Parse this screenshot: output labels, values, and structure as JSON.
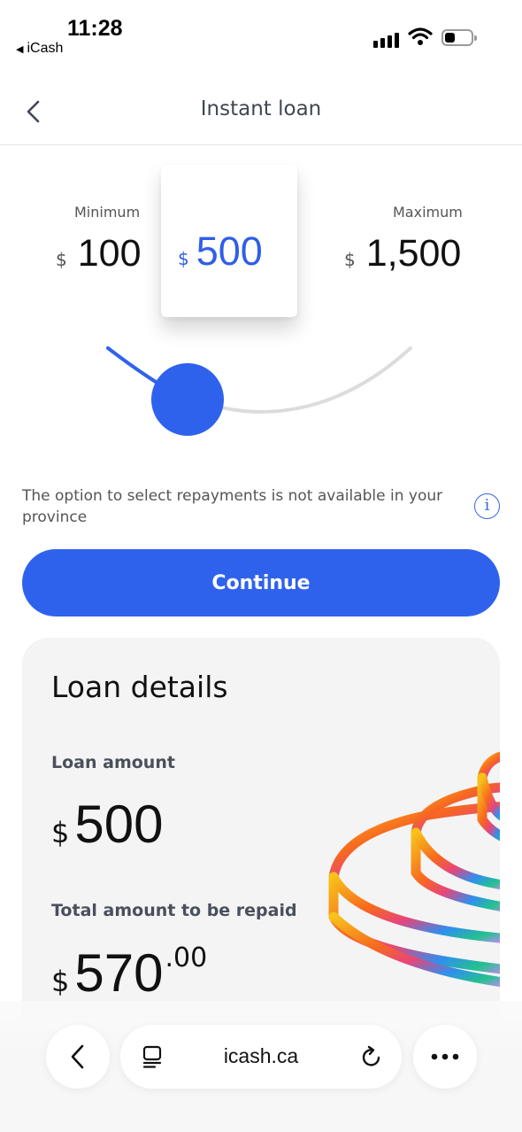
{
  "status_bar": {
    "time": "11:28",
    "back_app": "iCash",
    "battery_level": 0.25
  },
  "header": {
    "title": "Instant loan",
    "back_icon": "chevron-left-icon"
  },
  "amount_selector": {
    "currency": "$",
    "minimum_label": "Minimum",
    "minimum_value": "100",
    "maximum_label": "Maximum",
    "maximum_value": "1,500",
    "selected_value": "500",
    "slider_fraction": 0.286,
    "accent_color": "#2f62ec"
  },
  "info": {
    "text": "The option to select repayments is not available in your province",
    "icon": "info-icon"
  },
  "continue_button": {
    "label": "Continue"
  },
  "loan_details": {
    "title": "Loan details",
    "loan_amount_label": "Loan amount",
    "loan_amount_currency": "$",
    "loan_amount_value": "500",
    "total_label": "Total amount to be repaid",
    "total_currency": "$",
    "total_value": "570",
    "total_decimals": ".00"
  },
  "browser_bar": {
    "url": "icash.ca",
    "back_icon": "chevron-left-icon",
    "tabs_icon": "tabs-icon",
    "reload_icon": "reload-icon",
    "more_icon": "more-icon"
  }
}
